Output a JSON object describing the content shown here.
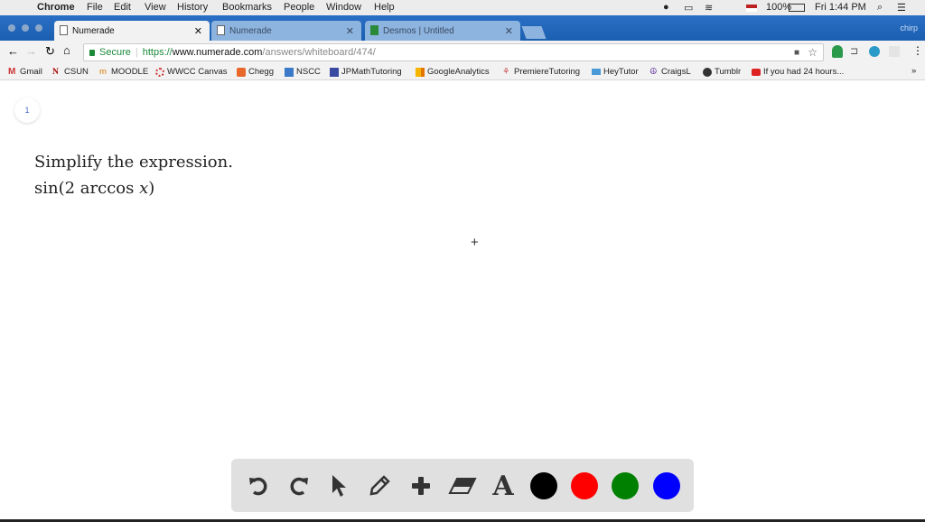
{
  "menubar": {
    "app": "Chrome",
    "items": [
      "File",
      "Edit",
      "View",
      "History",
      "Bookmarks",
      "People",
      "Window",
      "Help"
    ],
    "battery": "100%",
    "clock": "Fri 1:44 PM"
  },
  "tabs": [
    {
      "label": "Numerade",
      "active": true
    },
    {
      "label": "Numerade",
      "active": false
    },
    {
      "label": "Desmos | Untitled",
      "active": false
    }
  ],
  "profile": "chirp",
  "address": {
    "secure": "Secure",
    "scheme": "https://",
    "host": "www.numerade.com",
    "path": "/answers/whiteboard/474/"
  },
  "bookmarks": [
    "Gmail",
    "CSUN",
    "MOODLE",
    "WWCC Canvas",
    "Chegg",
    "NSCC",
    "JPMathTutoring",
    "GoogleAnalytics",
    "PremiereTutoring",
    "HeyTutor",
    "CraigsL",
    "Tumblr",
    "If you had 24 hours..."
  ],
  "page": {
    "number": "1",
    "line1": "Simplify the expression.",
    "line2_prefix": "sin(2 arccos ",
    "line2_var": "x",
    "line2_suffix": ")"
  },
  "tools": {
    "colors": {
      "black": "#000000",
      "red": "#ff0000",
      "green": "#008000",
      "blue": "#0000ff"
    },
    "text_tool": "A"
  }
}
